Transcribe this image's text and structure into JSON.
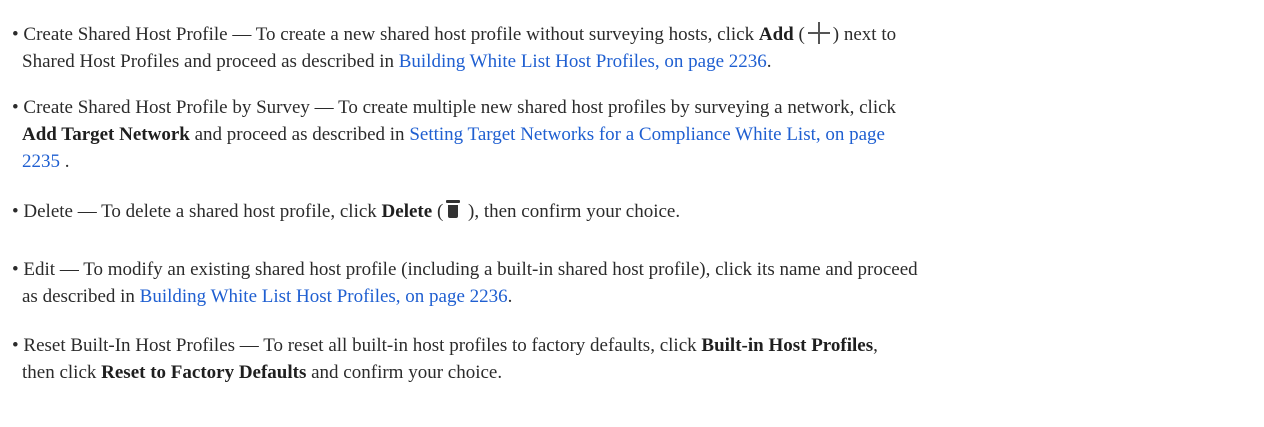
{
  "bullet": "•",
  "items": [
    {
      "lead": "Create Shared Host Profile — To create a new shared host profile without surveying hosts, click ",
      "bold1": "Add",
      "after_bold1_open": " (",
      "after_icon": ") next to",
      "line2_pre": "Shared Host Profiles and proceed as described in ",
      "link": "Building White List Host Profiles, on page 2236",
      "line2_post": "."
    },
    {
      "lead": "Create Shared Host Profile by Survey — To create multiple new shared host profiles by surveying a network, click",
      "bold1": "Add Target Network",
      "line2_mid": " and proceed as described in ",
      "link_part1": "Setting Target Networks for a Compliance White List, on page",
      "link_part2": "2235",
      "line3_post": " ."
    },
    {
      "lead": "Delete — To delete a shared host profile, click ",
      "bold1": "Delete",
      "after_bold1_open": " (",
      "after_icon": " ), then confirm your choice."
    },
    {
      "lead": "Edit — To modify an existing shared host profile (including a built-in shared host profile), click its name and proceed",
      "line2_pre": "as described in ",
      "link": "Building White List Host Profiles, on page 2236",
      "line2_post": "."
    },
    {
      "lead": "Reset Built-In Host Profiles — To reset all built-in host profiles to factory defaults, click ",
      "bold1": "Built-in Host Profiles",
      "after_bold1": ",",
      "line2_pre": "then click ",
      "bold2": "Reset to Factory Defaults",
      "line2_post": " and confirm your choice."
    }
  ]
}
